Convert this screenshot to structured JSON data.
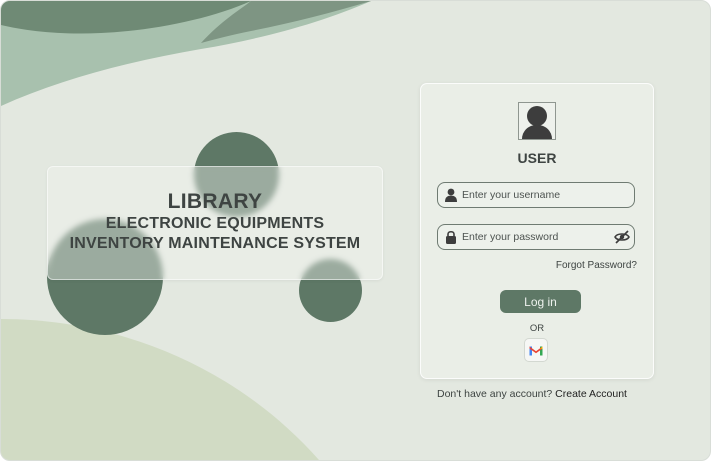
{
  "branding": {
    "title": "LIBRARY",
    "subtitle_line1": "ELECTRONIC EQUIPMENTS",
    "subtitle_line2": "INVENTORY MAINTENANCE SYSTEM"
  },
  "login": {
    "heading": "USER",
    "username_placeholder": "Enter your username",
    "password_placeholder": "Enter your password",
    "forgot_password": "Forgot Password?",
    "login_button": "Log in",
    "or_separator": "OR",
    "social_icon": "gmail-icon"
  },
  "signup": {
    "prompt": "Don't have any account?",
    "link": "Create Account"
  },
  "colors": {
    "accent": "#5e7866",
    "background": "#e3e8e0",
    "text": "#3e4442"
  },
  "icons": [
    "user-avatar-icon",
    "user-icon",
    "lock-icon",
    "eye-slash-icon",
    "gmail-icon"
  ]
}
